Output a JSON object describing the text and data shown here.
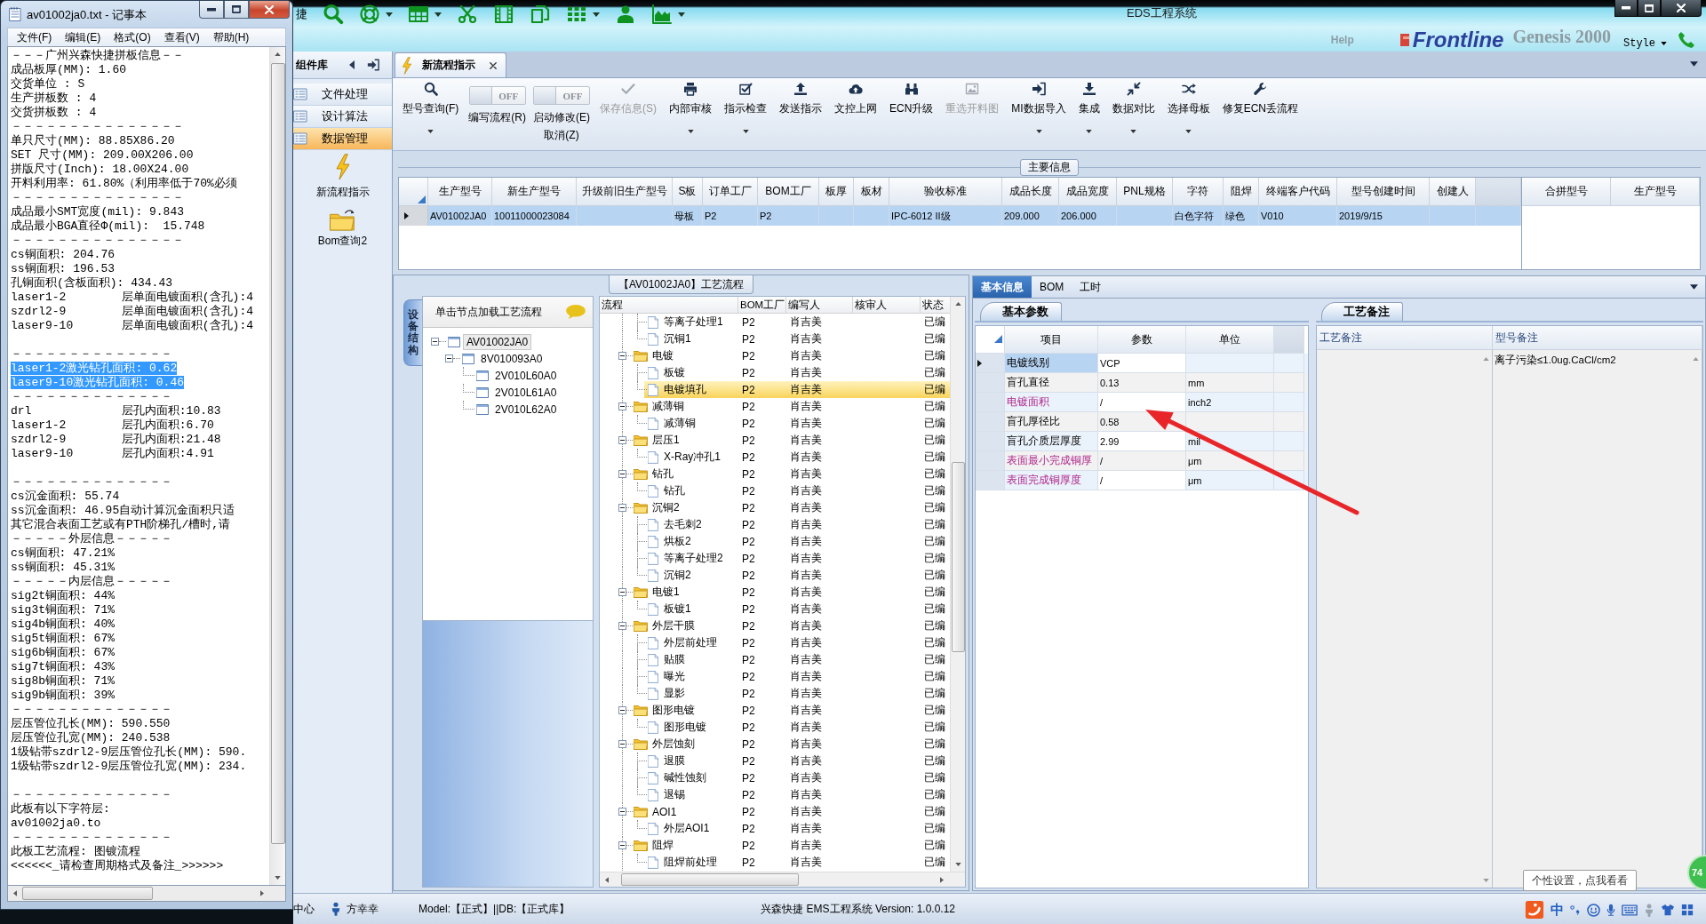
{
  "notepad": {
    "title": "av01002ja0.txt - 记事本",
    "menu": [
      "文件(F)",
      "编辑(E)",
      "格式(O)",
      "查看(V)",
      "帮助(H)"
    ],
    "blocks": [
      [
        {
          "text": "－－－广州兴森快捷拼板信息－－",
          "selected": false
        },
        {
          "text": "成品板厚(MM): 1.60",
          "selected": false
        },
        {
          "text": "交货单位 : S",
          "selected": false
        },
        {
          "text": "生产拼板数 : 4",
          "selected": false
        },
        {
          "text": "交货拼板数 : 4",
          "selected": false
        },
        {
          "text": "－－－－－－－－－－－－－－－",
          "selected": false
        },
        {
          "text": "单只尺寸(MM): 88.85X86.20",
          "selected": false
        },
        {
          "text": "SET 尺寸(MM): 209.00X206.00",
          "selected": false
        },
        {
          "text": "拼版尺寸(Inch): 18.00X24.00",
          "selected": false
        },
        {
          "text": "开料利用率: 61.80%（利用率低于70%必须",
          "selected": false
        },
        {
          "text": "－－－－－－－－－－－－－－－",
          "selected": false
        },
        {
          "text": "成品最小SMT宽度(mil): 9.843",
          "selected": false
        },
        {
          "text": "成品最小BGA直径Φ(mil):  15.748",
          "selected": false
        },
        {
          "text": "－－－－－－－－－－－－－－－",
          "selected": false
        },
        {
          "text": "cs铜面积: 204.76",
          "selected": false
        },
        {
          "text": "ss铜面积: 196.53",
          "selected": false
        },
        {
          "text": "孔铜面积(含板面积): 434.43",
          "selected": false
        },
        {
          "text": "laser1-2        层单面电镀面积(含孔):4",
          "selected": false
        },
        {
          "text": "szdrl2-9        层单面电镀面积(含孔):4",
          "selected": false
        },
        {
          "text": "laser9-10       层单面电镀面积(含孔):4",
          "selected": false
        }
      ],
      [
        {
          "text": "－－－－－－－－－－－－－－",
          "selected": false
        },
        {
          "text": "laser1-2激光钻孔面积: 0.62",
          "selected": true
        },
        {
          "text": "laser9-10激光钻孔面积: 0.46",
          "selected": true
        },
        {
          "text": "－－－－－－－－－－－－－－",
          "selected": false
        },
        {
          "text": "drl             层孔内面积:10.83",
          "selected": false
        },
        {
          "text": "laser1-2        层孔内面积:6.70",
          "selected": false
        },
        {
          "text": "szdrl2-9        层孔内面积:21.48",
          "selected": false
        },
        {
          "text": "laser9-10       层孔内面积:4.91",
          "selected": false
        }
      ],
      [
        {
          "text": "－－－－－－－－－－－－－－",
          "selected": false
        },
        {
          "text": "cs沉金面积: 55.74",
          "selected": false
        },
        {
          "text": "ss沉金面积: 46.95自动计算沉金面积只适",
          "selected": false
        },
        {
          "text": "其它混合表面工艺或有PTH阶梯孔/槽时,请",
          "selected": false
        },
        {
          "text": "－－－－－外层信息－－－－－",
          "selected": false
        },
        {
          "text": "cs铜面积: 47.21%",
          "selected": false
        },
        {
          "text": "ss铜面积: 45.31%",
          "selected": false
        },
        {
          "text": "－－－－－内层信息－－－－－",
          "selected": false
        },
        {
          "text": "sig2t铜面积: 44%",
          "selected": false
        },
        {
          "text": "sig3t铜面积: 71%",
          "selected": false
        },
        {
          "text": "sig4b铜面积: 40%",
          "selected": false
        },
        {
          "text": "sig5t铜面积: 67%",
          "selected": false
        },
        {
          "text": "sig6b铜面积: 67%",
          "selected": false
        },
        {
          "text": "sig7t铜面积: 43%",
          "selected": false
        },
        {
          "text": "sig8b铜面积: 71%",
          "selected": false
        },
        {
          "text": "sig9b铜面积: 39%",
          "selected": false
        },
        {
          "text": "－－－－－－－－－－－－－－",
          "selected": false
        },
        {
          "text": "层压管位孔长(MM): 590.550",
          "selected": false
        },
        {
          "text": "层压管位孔宽(MM): 240.538",
          "selected": false
        },
        {
          "text": "1级钻带szdrl2-9层压管位孔长(MM): 590.",
          "selected": false
        },
        {
          "text": "1级钻带szdrl2-9层压管位孔宽(MM): 234.",
          "selected": false
        }
      ],
      [
        {
          "text": "－－－－－－－－－－－－－－",
          "selected": false
        },
        {
          "text": "此板有以下字符层:",
          "selected": false
        },
        {
          "text": "av01002ja0.to",
          "selected": false
        },
        {
          "text": "－－－－－－－－－－－－－－",
          "selected": false
        },
        {
          "text": "此板工艺流程: 图镀流程",
          "selected": false
        },
        {
          "text": "<<<<<<_请检查周期格式及备注_>>>>>>",
          "selected": false
        }
      ]
    ]
  },
  "main_window": {
    "quick_access_text": "捷",
    "title": "EDS工程系统",
    "help": "Help",
    "logo": "Frontline",
    "product": "Genesis 2000",
    "style_menu": "Style",
    "components": {
      "title": "组件库",
      "items": [
        {
          "label": "文件处理",
          "selected": false
        },
        {
          "label": "设计算法",
          "selected": false
        },
        {
          "label": "数据管理",
          "selected": true
        }
      ],
      "shortcuts": [
        {
          "label": "新流程指示"
        },
        {
          "label": "Bom查询2"
        }
      ]
    },
    "doc_tabs": [
      {
        "label": "新流程指示",
        "selected": true
      }
    ],
    "ribbon": [
      {
        "kind": "button",
        "label": "型号查询(F)",
        "disabled": false,
        "menu": true
      },
      {
        "kind": "toggle",
        "label": "编写流程(R)",
        "on": false,
        "switch_text": "OFF"
      },
      {
        "kind": "toggle",
        "label": "启动修改(E)",
        "sublabel": "取消(Z)",
        "on": false,
        "switch_text": "OFF"
      },
      {
        "kind": "button",
        "label": "保存信息(S)",
        "disabled": true,
        "menu": false
      },
      {
        "kind": "button",
        "label": "内部审核",
        "disabled": false,
        "menu": true
      },
      {
        "kind": "button",
        "label": "指示检查",
        "disabled": false,
        "menu": true
      },
      {
        "kind": "button",
        "label": "发送指示",
        "disabled": false,
        "menu": false
      },
      {
        "kind": "button",
        "label": "文控上网",
        "disabled": false,
        "menu": false
      },
      {
        "kind": "button",
        "label": "ECN升级",
        "disabled": false,
        "menu": false
      },
      {
        "kind": "button",
        "label": "重选开料图",
        "disabled": true,
        "menu": false
      },
      {
        "kind": "button",
        "label": "MI数据导入",
        "disabled": false,
        "menu": true
      },
      {
        "kind": "button",
        "label": "集成",
        "disabled": false,
        "menu": true
      },
      {
        "kind": "button",
        "label": "数据对比",
        "disabled": false,
        "menu": true
      },
      {
        "kind": "button",
        "label": "选择母板",
        "disabled": false,
        "menu": true
      },
      {
        "kind": "button",
        "label": "修复ECN丢流程",
        "disabled": false,
        "menu": false
      }
    ],
    "main_info": {
      "title": "主要信息",
      "table": {
        "columns": [
          "生产型号",
          "新生产型号",
          "升级前旧生产型号",
          "S板",
          "订单工厂",
          "BOM工厂",
          "板厚",
          "板材",
          "验收标准",
          "成品长度",
          "成品宽度",
          "PNL规格",
          "字符",
          "阻焊",
          "终端客户代码",
          "型号创建时间",
          "创建人"
        ],
        "rows": [
          {
            "selected": true,
            "cells": [
              "AV01002JA0",
              "10011000023084",
              null,
              "母板",
              "P2",
              "P2",
              null,
              null,
              "IPC-6012 II级",
              "209.000",
              "206.000",
              null,
              "白色字符",
              "绿色",
              "V010",
              "2019/9/15",
              null
            ]
          }
        ]
      },
      "merge_table": {
        "columns": [
          "合拼型号",
          "生产型号"
        ]
      }
    },
    "process_flow": {
      "title": "【AV01002JA0】工艺流程",
      "side_tab": {
        "label": "设备结构",
        "selected": true
      },
      "tree_header": "单击节点加载工艺流程",
      "tree": [
        {
          "label": "AV01002JA0",
          "selected": true,
          "expanded": true,
          "children": [
            {
              "label": "8V010093A0",
              "selected": false,
              "expanded": true,
              "children": [
                {
                  "label": "2V010L60A0",
                  "selected": false
                },
                {
                  "label": "2V010L61A0",
                  "selected": false
                },
                {
                  "label": "2V010L62A0",
                  "selected": false
                }
              ]
            }
          ]
        }
      ],
      "flow_table": {
        "columns": [
          "流程",
          "BOM工厂",
          "编写人",
          "核审人",
          "状态"
        ],
        "rows": [
          {
            "kind": "continued",
            "children": [
              {
                "kind": "step",
                "name": "等离子处理1",
                "bom_factory": "P2",
                "writer": "肖吉美",
                "status": "已编",
                "selected": false
              },
              {
                "kind": "step",
                "name": "沉铜1",
                "bom_factory": "P2",
                "writer": "肖吉美",
                "status": "已编",
                "selected": false
              }
            ]
          },
          {
            "kind": "group",
            "name": "电镀",
            "bom_factory": "P2",
            "writer": "肖吉美",
            "status": "已编",
            "selected": false,
            "expanded": true,
            "children": [
              {
                "kind": "step",
                "name": "板镀",
                "bom_factory": "P2",
                "writer": "肖吉美",
                "status": "已编",
                "selected": false
              },
              {
                "kind": "step",
                "name": "电镀填孔",
                "bom_factory": "P2",
                "writer": "肖吉美",
                "status": "已编",
                "selected": true
              }
            ]
          },
          {
            "kind": "group",
            "name": "减薄铜",
            "bom_factory": "P2",
            "writer": "肖吉美",
            "status": "已编",
            "selected": false,
            "expanded": true,
            "children": [
              {
                "kind": "step",
                "name": "减薄铜",
                "bom_factory": "P2",
                "writer": "肖吉美",
                "status": "已编",
                "selected": false
              }
            ]
          },
          {
            "kind": "group",
            "name": "层压1",
            "bom_factory": "P2",
            "writer": "肖吉美",
            "status": "已编",
            "selected": false,
            "expanded": true,
            "children": [
              {
                "kind": "step",
                "name": "X-Ray冲孔1",
                "bom_factory": "P2",
                "writer": "肖吉美",
                "status": "已编",
                "selected": false
              }
            ]
          },
          {
            "kind": "group",
            "name": "钻孔",
            "bom_factory": "P2",
            "writer": "肖吉美",
            "status": "已编",
            "selected": false,
            "expanded": true,
            "children": [
              {
                "kind": "step",
                "name": "钻孔",
                "bom_factory": "P2",
                "writer": "肖吉美",
                "status": "已编",
                "selected": false
              }
            ]
          },
          {
            "kind": "group",
            "name": "沉铜2",
            "bom_factory": "P2",
            "writer": "肖吉美",
            "status": "已编",
            "selected": false,
            "expanded": true,
            "children": [
              {
                "kind": "step",
                "name": "去毛刺2",
                "bom_factory": "P2",
                "writer": "肖吉美",
                "status": "已编",
                "selected": false
              },
              {
                "kind": "step",
                "name": "烘板2",
                "bom_factory": "P2",
                "writer": "肖吉美",
                "status": "已编",
                "selected": false
              },
              {
                "kind": "step",
                "name": "等离子处理2",
                "bom_factory": "P2",
                "writer": "肖吉美",
                "status": "已编",
                "selected": false
              },
              {
                "kind": "step",
                "name": "沉铜2",
                "bom_factory": "P2",
                "writer": "肖吉美",
                "status": "已编",
                "selected": false
              }
            ]
          },
          {
            "kind": "group",
            "name": "电镀1",
            "bom_factory": "P2",
            "writer": "肖吉美",
            "status": "已编",
            "selected": false,
            "expanded": true,
            "children": [
              {
                "kind": "step",
                "name": "板镀1",
                "bom_factory": "P2",
                "writer": "肖吉美",
                "status": "已编",
                "selected": false
              }
            ]
          },
          {
            "kind": "group",
            "name": "外层干膜",
            "bom_factory": "P2",
            "writer": "肖吉美",
            "status": "已编",
            "selected": false,
            "expanded": true,
            "children": [
              {
                "kind": "step",
                "name": "外层前处理",
                "bom_factory": "P2",
                "writer": "肖吉美",
                "status": "已编",
                "selected": false
              },
              {
                "kind": "step",
                "name": "贴膜",
                "bom_factory": "P2",
                "writer": "肖吉美",
                "status": "已编",
                "selected": false
              },
              {
                "kind": "step",
                "name": "曝光",
                "bom_factory": "P2",
                "writer": "肖吉美",
                "status": "已编",
                "selected": false
              },
              {
                "kind": "step",
                "name": "显影",
                "bom_factory": "P2",
                "writer": "肖吉美",
                "status": "已编",
                "selected": false
              }
            ]
          },
          {
            "kind": "group",
            "name": "图形电镀",
            "bom_factory": "P2",
            "writer": "肖吉美",
            "status": "已编",
            "selected": false,
            "expanded": true,
            "children": [
              {
                "kind": "step",
                "name": "图形电镀",
                "bom_factory": "P2",
                "writer": "肖吉美",
                "status": "已编",
                "selected": false
              }
            ]
          },
          {
            "kind": "group",
            "name": "外层蚀刻",
            "bom_factory": "P2",
            "writer": "肖吉美",
            "status": "已编",
            "selected": false,
            "expanded": true,
            "children": [
              {
                "kind": "step",
                "name": "退膜",
                "bom_factory": "P2",
                "writer": "肖吉美",
                "status": "已编",
                "selected": false
              },
              {
                "kind": "step",
                "name": "碱性蚀刻",
                "bom_factory": "P2",
                "writer": "肖吉美",
                "status": "已编",
                "selected": false
              },
              {
                "kind": "step",
                "name": "退锡",
                "bom_factory": "P2",
                "writer": "肖吉美",
                "status": "已编",
                "selected": false
              }
            ]
          },
          {
            "kind": "group",
            "name": "AOI1",
            "bom_factory": "P2",
            "writer": "肖吉美",
            "status": "已编",
            "selected": false,
            "expanded": true,
            "children": [
              {
                "kind": "step",
                "name": "外层AOI1",
                "bom_factory": "P2",
                "writer": "肖吉美",
                "status": "已编",
                "selected": false
              }
            ]
          },
          {
            "kind": "group",
            "name": "阻焊",
            "bom_factory": "P2",
            "writer": "肖吉美",
            "status": "已编",
            "selected": false,
            "expanded": true,
            "children": [
              {
                "kind": "step",
                "name": "阻焊前处理",
                "bom_factory": "P2",
                "writer": "肖吉美",
                "status": "已编",
                "selected": false
              }
            ]
          }
        ]
      }
    },
    "detail_tabs": [
      {
        "label": "基本信息",
        "selected": true
      },
      {
        "label": "BOM",
        "selected": false
      },
      {
        "label": "工时",
        "selected": false
      }
    ],
    "basic_params": {
      "tab": {
        "label": "基本参数",
        "selected": true
      },
      "columns": [
        "项目",
        "参数",
        "单位"
      ],
      "rows": [
        {
          "item": "电镀线别",
          "value": "VCP",
          "flagged": false,
          "selected": true
        },
        {
          "item": "盲孔直径",
          "value": "0.13",
          "unit": "mm",
          "flagged": false,
          "selected": false
        },
        {
          "item": "电镀面积",
          "value": "/",
          "unit": "inch2",
          "flagged": true,
          "selected": false
        },
        {
          "item": "盲孔厚径比",
          "value": "0.58",
          "flagged": false,
          "selected": false
        },
        {
          "item": "盲孔介质层厚度",
          "value": "2.99",
          "unit": "mil",
          "flagged": false,
          "selected": false
        },
        {
          "item": "表面最小完成铜厚",
          "value": "/",
          "unit": "μm",
          "flagged": true,
          "selected": false
        },
        {
          "item": "表面完成铜厚度",
          "value": "/",
          "unit": "μm",
          "flagged": true,
          "selected": false
        }
      ]
    },
    "process_notes": {
      "tab": {
        "label": "工艺备注",
        "selected": true
      },
      "columns": [
        "工艺备注",
        "型号备注"
      ],
      "rows": [
        {
          "model_note": "离子污染≤1.0ug.CaCl/cm2"
        }
      ]
    },
    "status_bar": [
      {
        "kind": "text",
        "text": "中心"
      },
      {
        "kind": "user",
        "text": "方幸幸"
      },
      {
        "kind": "text",
        "text": "Model:【正式】||DB:【正式库】"
      },
      {
        "kind": "text",
        "text": "兴森快捷 EMS工程系统 Version: 1.0.0.12"
      }
    ],
    "ime": {
      "mode": "中",
      "tooltip": "个性设置，点我看看"
    },
    "badge": "74"
  }
}
